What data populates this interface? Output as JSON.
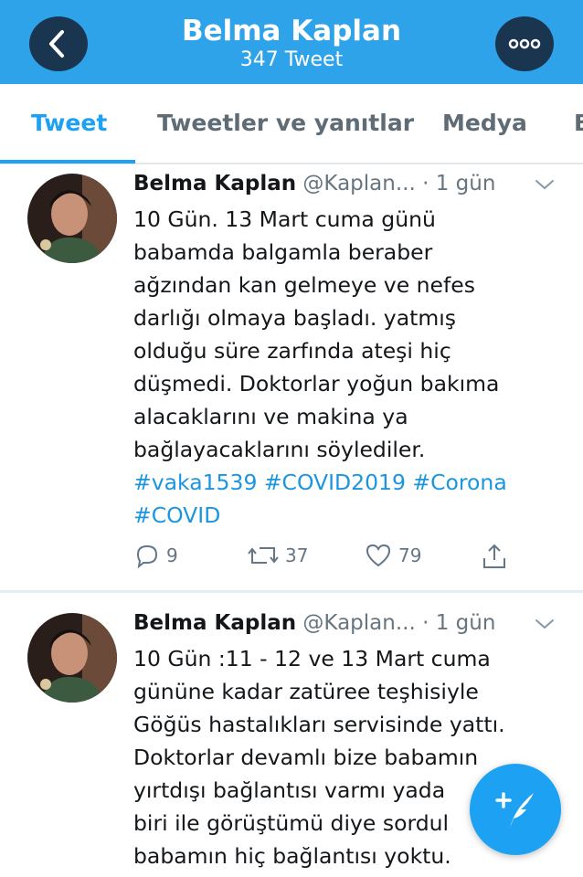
{
  "header": {
    "title": "Belma Kaplan",
    "subtitle": "347 Tweet",
    "back_icon": "chevron-left-icon",
    "more_icon": "more-horizontal-icon",
    "color": "#2fa3e9"
  },
  "tabs": [
    {
      "label": "Tweet",
      "active": true
    },
    {
      "label": "Tweetler ve yanıtlar",
      "active": false
    },
    {
      "label": "Medya",
      "active": false
    },
    {
      "label": "B",
      "active": false
    }
  ],
  "tweets": [
    {
      "author": "Belma Kaplan",
      "handle": "@Kaplan...",
      "time": "· 1 gün",
      "lines": [
        "10 Gün. 13 Mart cuma günü",
        "babamda balgamla beraber",
        "ağzından kan gelmeye ve nefes",
        "darlığı olmaya başladı. yatmış",
        "olduğu süre zarfında ateşi hiç",
        "düşmedi. Doktorlar yoğun bakıma",
        "alacaklarını ve makina ya",
        "bağlayacaklarını söylediler."
      ],
      "hashtags_line1": "#vaka1539 #COVID2019 #Corona",
      "hashtags_line2": "#COVID",
      "replies": "9",
      "retweets": "37",
      "likes": "79"
    },
    {
      "author": "Belma Kaplan",
      "handle": "@Kaplan...",
      "time": "· 1 gün",
      "lines": [
        "10 Gün :11 - 12 ve 13 Mart cuma",
        "gününe kadar zatüree teşhisiyle",
        "Göğüs hastalıkları servisinde yattı.",
        "Doktorlar devamlı bize babamın",
        "yırtdışı bağlantısı varmı yada",
        "biri ile görüştümü diye sordul",
        "babamın hiç bağlantısı yoktu."
      ]
    }
  ],
  "fab": {
    "icon": "compose-tweet-icon",
    "color": "#1da1f2"
  },
  "colors": {
    "accent": "#1da1f2",
    "hashtag": "#1b95e0",
    "muted": "#657786"
  }
}
